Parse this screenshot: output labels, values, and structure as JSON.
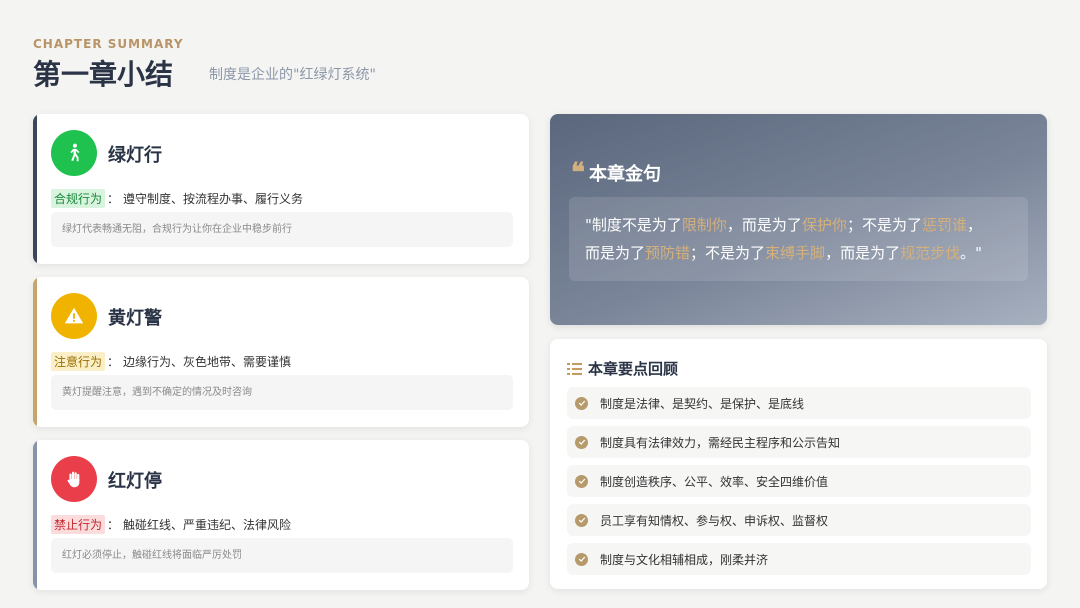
{
  "header": {
    "eyebrow": "CHAPTER SUMMARY",
    "title": "第一章小结",
    "subtitle": "制度是企业的\"红绿灯系统\""
  },
  "lights": [
    {
      "title": "绿灯行",
      "tag": "合规行为",
      "colon": "：",
      "desc": "遵守制度、按流程办事、履行义务",
      "note": "绿灯代表畅通无阻，合规行为让你在企业中稳步前行",
      "icon": "walking-person-icon",
      "color": "#1fc24f"
    },
    {
      "title": "黄灯警",
      "tag": "注意行为",
      "colon": "：",
      "desc": "边缘行为、灰色地带、需要谨慎",
      "note": "黄灯提醒注意，遇到不确定的情况及时咨询",
      "icon": "warning-triangle-icon",
      "color": "#f0b400"
    },
    {
      "title": "红灯停",
      "tag": "禁止行为",
      "colon": "：",
      "desc": "触碰红线、严重违纪、法律风险",
      "note": "红灯必须停止，触碰红线将面临严厉处罚",
      "icon": "stop-hand-icon",
      "color": "#ea3f4a"
    }
  ],
  "quote": {
    "heading": "本章金句",
    "icon": "quote-icon",
    "parts": [
      "\"制度不是为了",
      "限制你",
      "，而是为了",
      "保护你",
      "；不是为了",
      "惩罚谁",
      "，",
      "而是为了",
      "预防错",
      "；不是为了",
      "束缚手脚",
      "，而是为了",
      "规范步伐",
      "。\""
    ]
  },
  "review": {
    "heading": "本章要点回顾",
    "icon": "list-icon",
    "items": [
      "制度是法律、是契约、是保护、是底线",
      "制度具有法律效力，需经民主程序和公示告知",
      "制度创造秩序、公平、效率、安全四维价值",
      "员工享有知情权、参与权、申诉权、监督权",
      "制度与文化相辅相成，刚柔并济"
    ]
  },
  "colors": {
    "accent_gold": "#b89467",
    "title_navy": "#2a3446",
    "highlight": "#d6b07b"
  }
}
